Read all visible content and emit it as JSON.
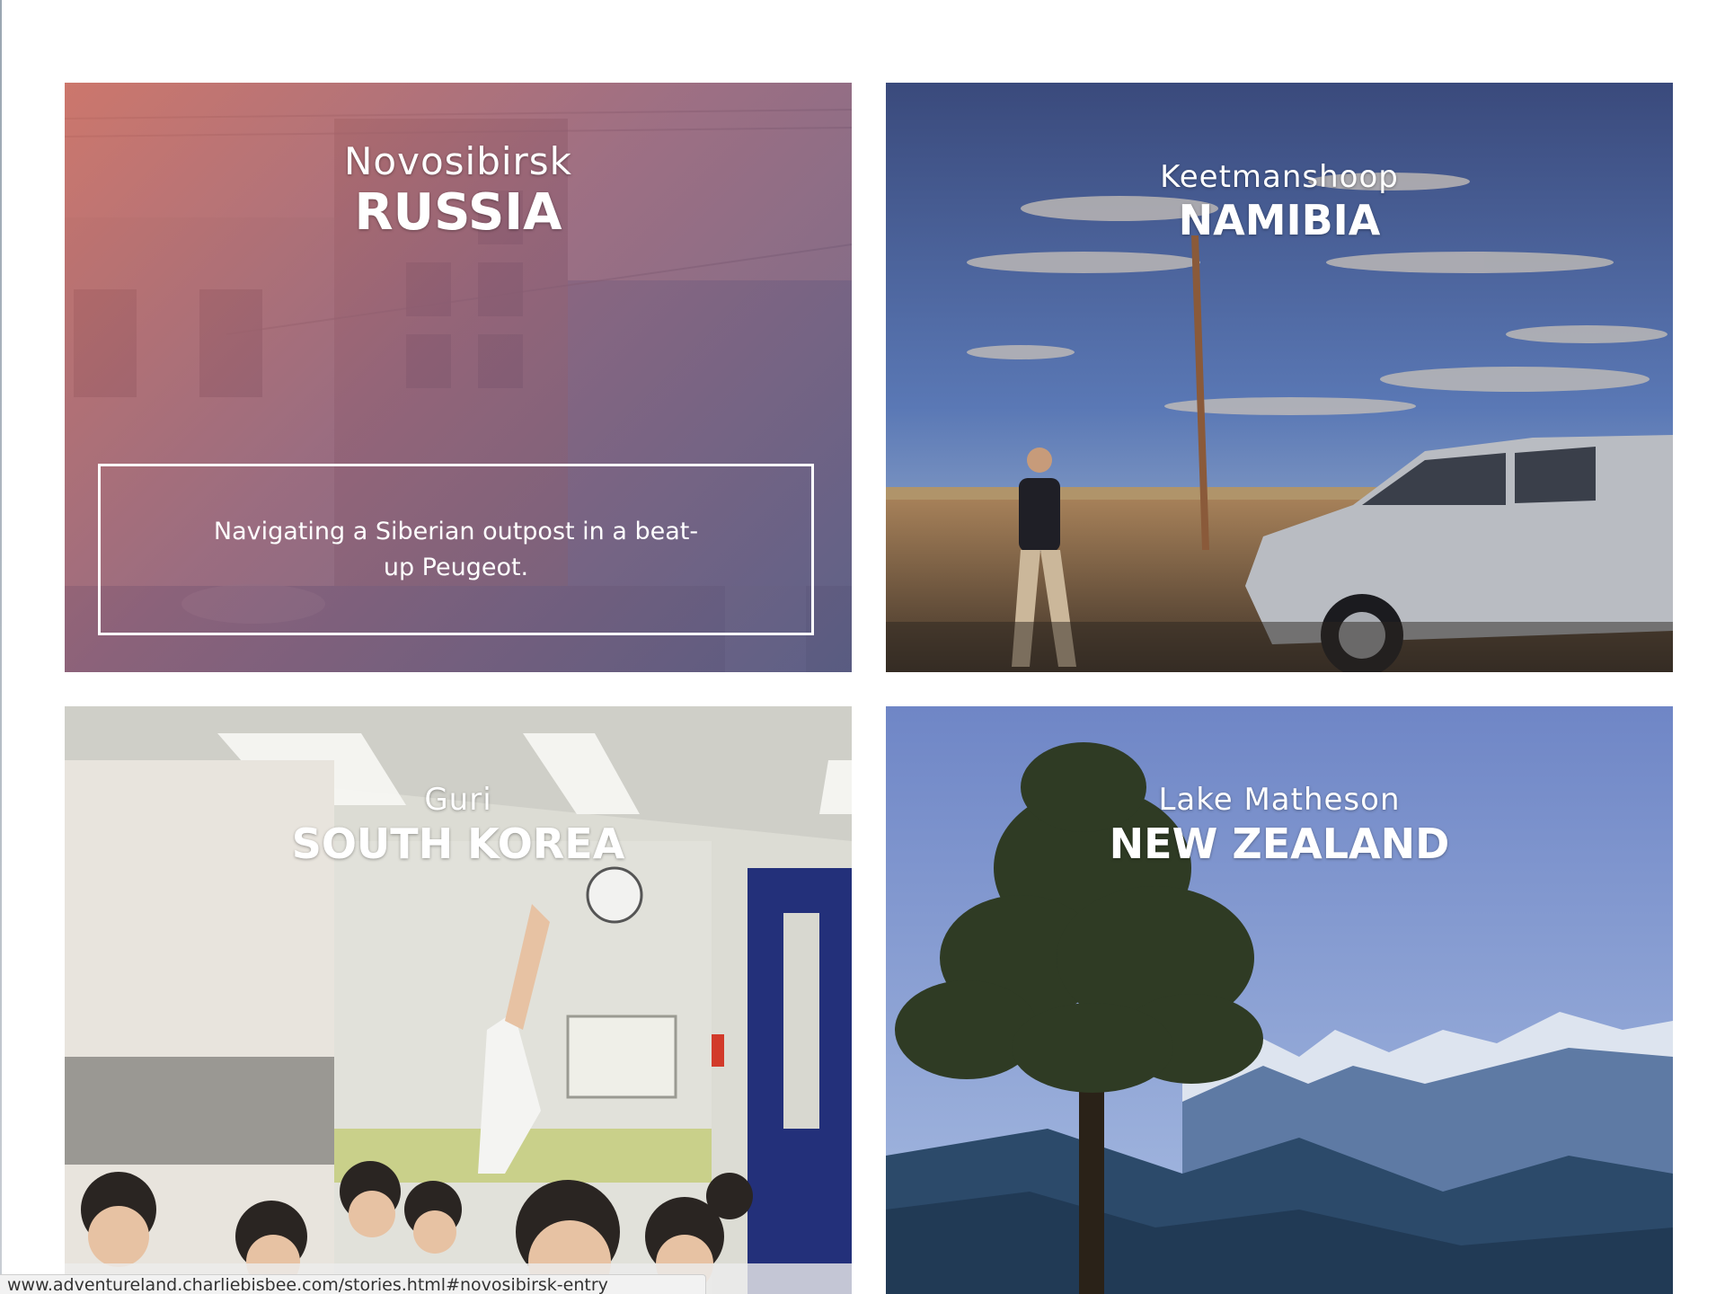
{
  "cards": [
    {
      "city": "Novosibirsk",
      "country": "RUSSIA",
      "description": "Navigating a Siberian outpost in a beat-up Peugeot."
    },
    {
      "city": "Keetmanshoop",
      "country": "NAMIBIA"
    },
    {
      "city": "Guri",
      "country": "SOUTH KOREA"
    },
    {
      "city": "Lake Matheson",
      "country": "NEW ZEALAND"
    }
  ],
  "status_bar": {
    "url": "www.adventureland.charliebisbee.com/stories.html#novosibirsk-entry"
  },
  "colors": {
    "overlay_start": "#d26e5f",
    "overlay_end": "#505582",
    "text": "#ffffff"
  }
}
